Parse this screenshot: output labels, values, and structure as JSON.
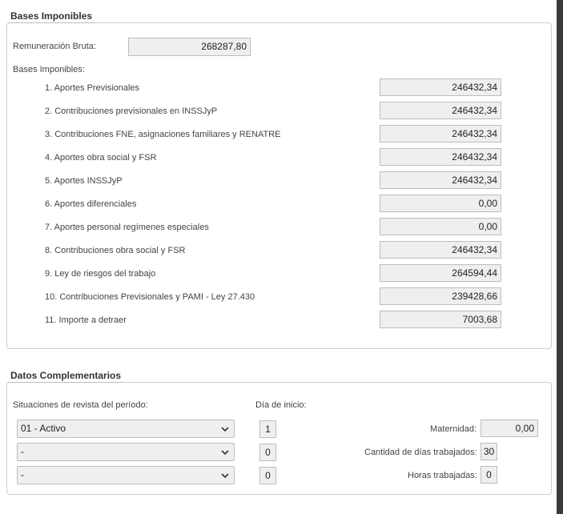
{
  "bases": {
    "legend": "Bases Imponibles",
    "remuneracion_label": "Remuneración Bruta:",
    "remuneracion_value": "268287,80",
    "subtitle": "Bases Imponibles:",
    "items": [
      {
        "label": "1. Aportes Previsionales",
        "value": "246432,34"
      },
      {
        "label": "2. Contribuciones previsionales en INSSJyP",
        "value": "246432,34"
      },
      {
        "label": "3. Contribuciones FNE, asignaciones familiares y RENATRE",
        "value": "246432,34"
      },
      {
        "label": "4. Aportes obra social y FSR",
        "value": "246432,34"
      },
      {
        "label": "5. Aportes INSSJyP",
        "value": "246432,34"
      },
      {
        "label": "6. Aportes diferenciales",
        "value": "0,00"
      },
      {
        "label": "7. Aportes personal regímenes especiales",
        "value": "0,00"
      },
      {
        "label": "8. Contribuciones obra social y FSR",
        "value": "246432,34"
      },
      {
        "label": "9. Ley de riesgos del trabajo",
        "value": "264594,44"
      },
      {
        "label": "10. Contribuciones Previsionales y PAMI - Ley 27.430",
        "value": "239428,66"
      },
      {
        "label": "11. Importe a detraer",
        "value": "7003,68"
      }
    ]
  },
  "complementarios": {
    "legend": "Datos Complementarios",
    "situaciones_label": "Situaciones de revista del período:",
    "dia_label": "Día de inicio:",
    "rows": [
      {
        "situacion": "01 - Activo",
        "dia": "1"
      },
      {
        "situacion": "-",
        "dia": "0"
      },
      {
        "situacion": "-",
        "dia": "0"
      }
    ],
    "maternidad_label": "Maternidad:",
    "maternidad_value": "0,00",
    "dias_label": "Cantidad de días trabajados:",
    "dias_value": "30",
    "horas_label": "Horas trabajadas:",
    "horas_value": "0"
  },
  "icons": {
    "select_arrow": "chevron-down-icon"
  }
}
